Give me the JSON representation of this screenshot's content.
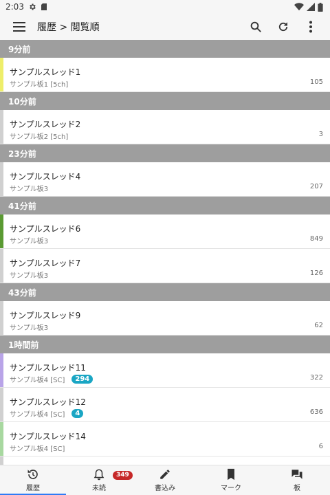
{
  "status": {
    "time": "2:03"
  },
  "app_bar": {
    "title": "履歴 > 閲覧順"
  },
  "sections": [
    {
      "header": "9分前",
      "items": [
        {
          "title": "サンプルスレッド1",
          "board": "サンプル板1 [5ch]",
          "count": "105",
          "stripe": "#eeee6a"
        }
      ]
    },
    {
      "header": "10分前",
      "items": [
        {
          "title": "サンプルスレッド2",
          "board": "サンプル板2 [5ch]",
          "count": "3",
          "stripe": "#d0d0d0"
        }
      ]
    },
    {
      "header": "23分前",
      "items": [
        {
          "title": "サンプルスレッド4",
          "board": "サンプル板3",
          "count": "207",
          "stripe": "#d0d0d0"
        }
      ]
    },
    {
      "header": "41分前",
      "items": [
        {
          "title": "サンプルスレッド6",
          "board": "サンプル板3",
          "count": "849",
          "stripe": "#5a9a32"
        },
        {
          "title": "サンプルスレッド7",
          "board": "サンプル板3",
          "count": "126",
          "stripe": "#d0d0d0"
        }
      ]
    },
    {
      "header": "43分前",
      "items": [
        {
          "title": "サンプルスレッド9",
          "board": "サンプル板3",
          "count": "62",
          "stripe": "#d0d0d0"
        }
      ]
    },
    {
      "header": "1時間前",
      "items": [
        {
          "title": "サンプルスレッド11",
          "board": "サンプル板4 [SC]",
          "count": "322",
          "badge": "294",
          "stripe": "#b9a4e8"
        },
        {
          "title": "サンプルスレッド12",
          "board": "サンプル板4 [SC]",
          "count": "636",
          "badge": "4",
          "stripe": "#d0d0d0"
        },
        {
          "title": "サンプルスレッド14",
          "board": "サンプル板4 [SC]",
          "count": "6",
          "stripe": "#a8d8a0"
        }
      ]
    }
  ],
  "bottom_nav": {
    "history": "履歴",
    "unread": "未読",
    "unread_badge": "349",
    "post": "書込み",
    "mark": "マーク",
    "board": "板"
  }
}
